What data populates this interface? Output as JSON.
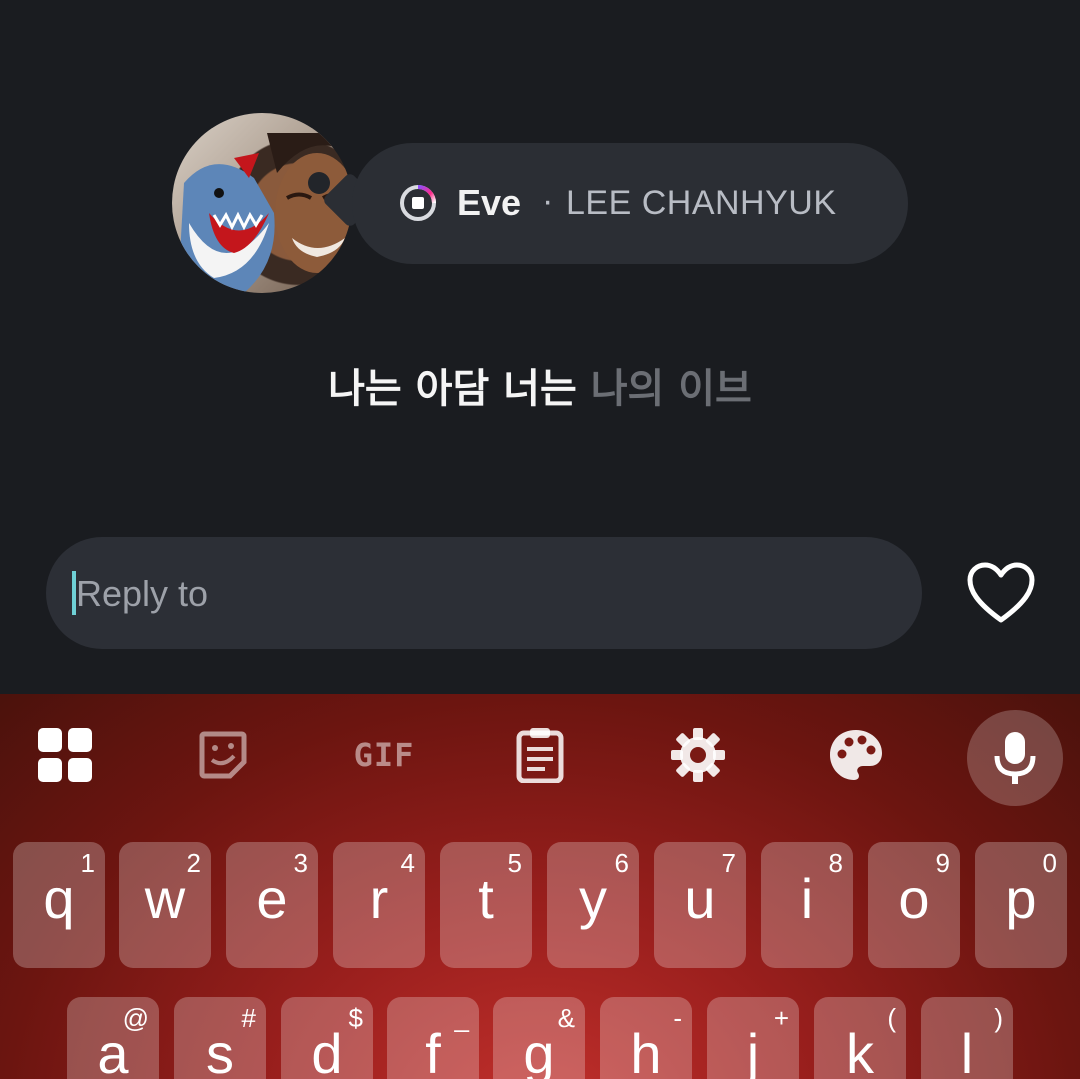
{
  "now_playing": {
    "song": "Eve",
    "separator": "·",
    "artist": "LEE CHANHYUK"
  },
  "lyrics": {
    "sung": "나는 아담 너는",
    "pending": "나의 이브"
  },
  "reply": {
    "placeholder": "Reply to"
  },
  "keyboard": {
    "toolbar": [
      "apps-grid-icon",
      "sticker-icon",
      "gif-icon",
      "clipboard-icon",
      "settings-icon",
      "palette-icon",
      "microphone-icon"
    ],
    "gif_label": "GIF",
    "row1": [
      {
        "key": "q",
        "hint": "1"
      },
      {
        "key": "w",
        "hint": "2"
      },
      {
        "key": "e",
        "hint": "3"
      },
      {
        "key": "r",
        "hint": "4"
      },
      {
        "key": "t",
        "hint": "5"
      },
      {
        "key": "y",
        "hint": "6"
      },
      {
        "key": "u",
        "hint": "7"
      },
      {
        "key": "i",
        "hint": "8"
      },
      {
        "key": "o",
        "hint": "9"
      },
      {
        "key": "p",
        "hint": "0"
      }
    ],
    "row2": [
      {
        "key": "a",
        "hint": "@"
      },
      {
        "key": "s",
        "hint": "#"
      },
      {
        "key": "d",
        "hint": "$"
      },
      {
        "key": "f",
        "hint": "_"
      },
      {
        "key": "g",
        "hint": "&"
      },
      {
        "key": "h",
        "hint": "-"
      },
      {
        "key": "j",
        "hint": "+"
      },
      {
        "key": "k",
        "hint": "("
      },
      {
        "key": "l",
        "hint": ")"
      }
    ]
  },
  "colors": {
    "background": "#1a1c20",
    "bubble": "#2b2e34",
    "reply_field": "#2c2f36",
    "caret": "#6fd0d6",
    "keyboard_red": "#9a1f1d"
  }
}
